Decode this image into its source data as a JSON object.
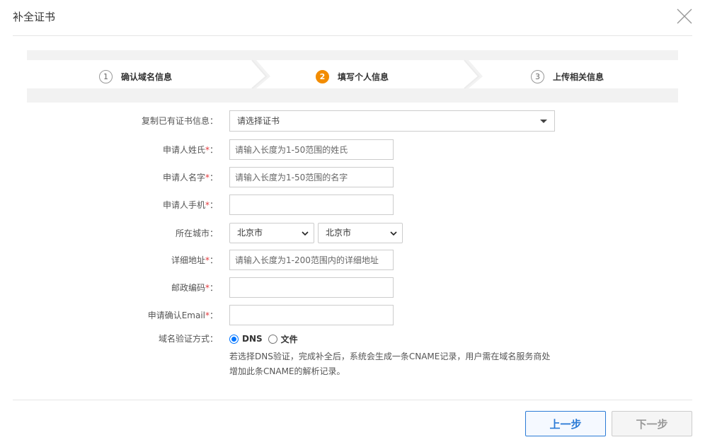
{
  "dialog": {
    "title": "补全证书"
  },
  "steps": [
    {
      "num": "1",
      "label": "确认域名信息"
    },
    {
      "num": "2",
      "label": "填写个人信息"
    },
    {
      "num": "3",
      "label": "上传相关信息"
    }
  ],
  "form": {
    "copy_cert": {
      "label": "复制已有证书信息：",
      "value": "请选择证书"
    },
    "last_name": {
      "label": "申请人姓氏",
      "req": "*",
      "colon": "：",
      "placeholder": "请输入长度为1-50范围的姓氏"
    },
    "first_name": {
      "label": "申请人名字",
      "req": "*",
      "colon": "：",
      "placeholder": "请输入长度为1-50范围的名字"
    },
    "phone": {
      "label": "申请人手机",
      "req": "*",
      "colon": "：",
      "placeholder": ""
    },
    "city": {
      "label": "所在城市：",
      "province_value": "北京市",
      "city_value": "北京市"
    },
    "address": {
      "label": "详细地址",
      "req": "*",
      "colon": "：",
      "placeholder": "请输入长度为1-200范围内的详细地址"
    },
    "postcode": {
      "label": "邮政编码",
      "req": "*",
      "colon": "：",
      "placeholder": ""
    },
    "email": {
      "label": "申请确认Email",
      "req": "*",
      "colon": "：",
      "placeholder": ""
    },
    "verify": {
      "label": "域名验证方式：",
      "options": [
        {
          "label": "DNS",
          "checked": true
        },
        {
          "label": "文件",
          "checked": false
        }
      ],
      "hint_line1": "若选择DNS验证，完成补全后，系统会生成一条CNAME记录，用户需在域名服务商处",
      "hint_line2": "增加此条CNAME的解析记录。"
    }
  },
  "footer": {
    "prev_label": "上一步",
    "next_label": "下一步"
  },
  "colors": {
    "accent": "#2b7bd6",
    "active_step": "#f28c00",
    "required": "#e4393c"
  }
}
